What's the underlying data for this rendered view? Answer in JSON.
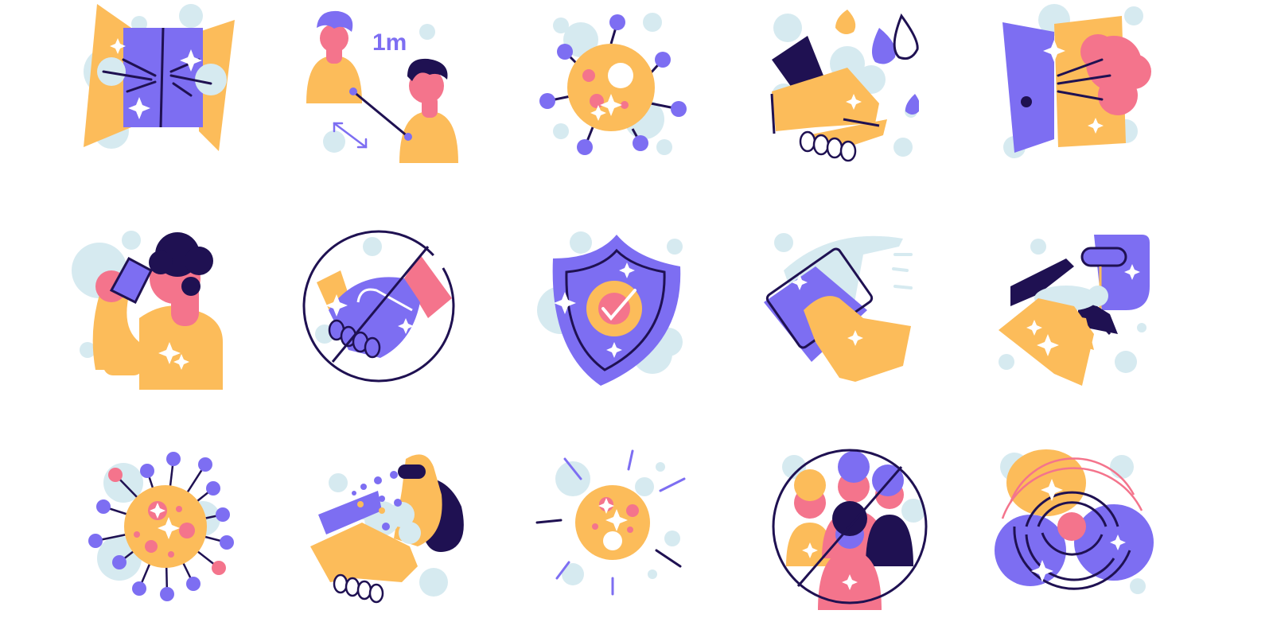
{
  "palette": {
    "yellow": "#fcbc5a",
    "purple": "#7d6ef2",
    "pink": "#f4748c",
    "navy": "#1f1152",
    "pale_blue": "#d6eaf0",
    "white": "#ffffff"
  },
  "icons": [
    {
      "name": "open-window-fresh-air-icon"
    },
    {
      "name": "social-distance-1m-icon",
      "distance_label": "1m"
    },
    {
      "name": "virus-cell-icon"
    },
    {
      "name": "wash-hands-icon"
    },
    {
      "name": "open-door-ventilation-icon"
    },
    {
      "name": "drink-water-icon"
    },
    {
      "name": "no-handshake-icon"
    },
    {
      "name": "protection-shield-check-icon"
    },
    {
      "name": "wipe-surface-icon"
    },
    {
      "name": "soap-dispenser-icon"
    },
    {
      "name": "coronavirus-icon"
    },
    {
      "name": "hand-soap-foam-icon"
    },
    {
      "name": "bacteria-germ-icon"
    },
    {
      "name": "no-crowds-icon"
    },
    {
      "name": "spreading-infection-icon"
    }
  ]
}
